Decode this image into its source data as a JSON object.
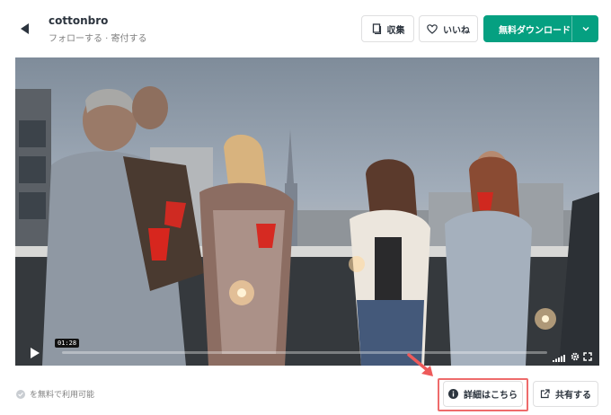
{
  "header": {
    "author_name": "cottonbro",
    "author_sub": "フォローする · 寄付する",
    "back_icon": "back-arrow-icon"
  },
  "actions": {
    "collect_label": "収集",
    "like_label": "いいね",
    "download_label": "無料ダウンロード"
  },
  "video": {
    "current_time": "01:28",
    "progress": 0.0,
    "controls": [
      "play-icon",
      "volume-icon",
      "settings-icon",
      "fullscreen-icon"
    ]
  },
  "footer": {
    "free_text": "を無料で利用可能",
    "detail_label": "詳細はこちら",
    "share_label": "共有する"
  },
  "colors": {
    "accent": "#05a081",
    "highlight": "#ee6b6b",
    "text": "#2c343e",
    "muted": "#7f7f7f"
  }
}
